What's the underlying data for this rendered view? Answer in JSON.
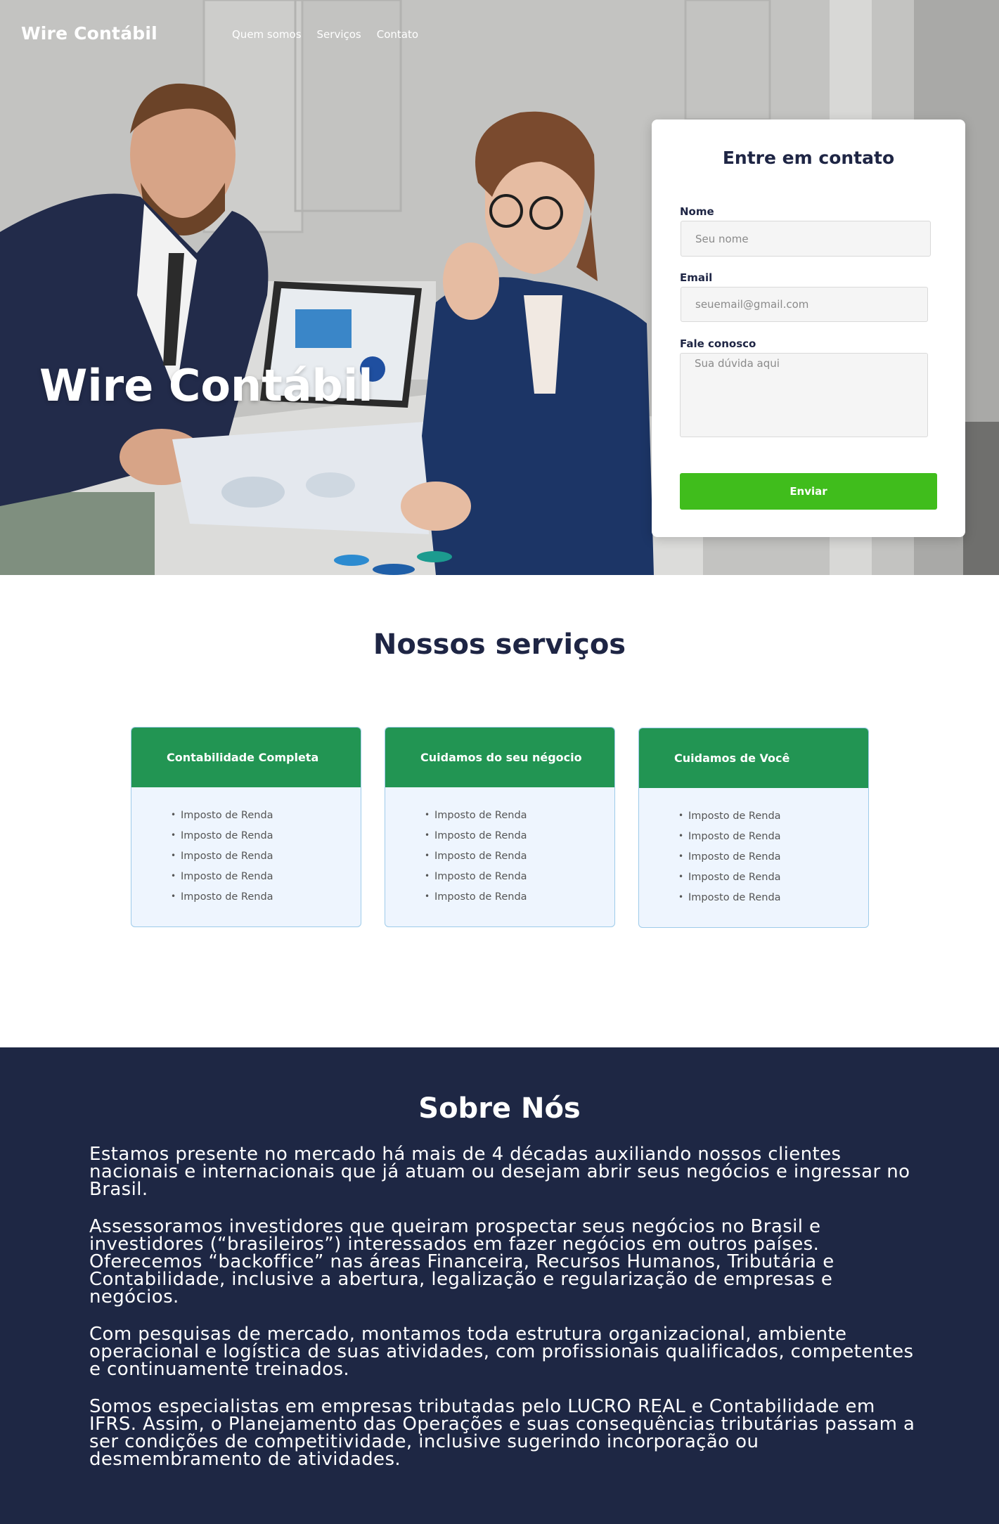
{
  "nav": {
    "logo": "Wire Contábil",
    "links": [
      "Quem somos",
      "Serviços",
      "Contato"
    ]
  },
  "hero": {
    "title": "Wire Contábil"
  },
  "contact": {
    "title": "Entre em contato",
    "name_label": "Nome",
    "name_placeholder": "Seu nome",
    "email_label": "Email",
    "email_placeholder": "seuemail@gmail.com",
    "message_label": "Fale conosco",
    "message_placeholder": "Sua dúvida aqui",
    "submit_label": "Enviar"
  },
  "services": {
    "title": "Nossos serviços",
    "cards": [
      {
        "title": "Contabilidade Completa",
        "items": [
          "Imposto de Renda",
          "Imposto de Renda",
          "Imposto de Renda",
          "Imposto de Renda",
          "Imposto de Renda"
        ]
      },
      {
        "title": "Cuidamos do seu négocio",
        "items": [
          "Imposto de Renda",
          "Imposto de Renda",
          "Imposto de Renda",
          "Imposto de Renda",
          "Imposto de Renda"
        ]
      },
      {
        "title": "Cuidamos de Você",
        "items": [
          "Imposto de Renda",
          "Imposto de Renda",
          "Imposto de Renda",
          "Imposto de Renda",
          "Imposto de Renda"
        ]
      }
    ]
  },
  "about": {
    "title": "Sobre Nós",
    "paragraphs": [
      "Estamos presente no mercado há mais de 4 décadas auxiliando nossos clientes nacionais e internacionais que já atuam ou desejam abrir seus negócios e ingressar no Brasil.",
      "Assessoramos investidores que queiram prospectar seus negócios no Brasil e investidores (“brasileiros”) interessados em fazer negócios em outros países.",
      "Oferecemos “backoffice” nas áreas Financeira, Recursos Humanos, Tributária e Contabilidade, inclusive a abertura, legalização e regularização de empresas e negócios.",
      "Com pesquisas de mercado, montamos toda estrutura organizacional, ambiente operacional e logística de suas atividades, com profissionais qualificados, competentes e continuamente treinados.",
      "Somos especialistas em empresas tributadas pelo LUCRO REAL e Contabilidade em IFRS. Assim, o Planejamento das Operações e suas consequências tributárias passam a ser condições de competitividade, inclusive sugerindo incorporação ou desmembramento de atividades."
    ]
  },
  "colors": {
    "navy": "#1e2744",
    "green_button": "#40bd1c",
    "card_header_green": "#229553",
    "card_body": "#eef5fe"
  }
}
